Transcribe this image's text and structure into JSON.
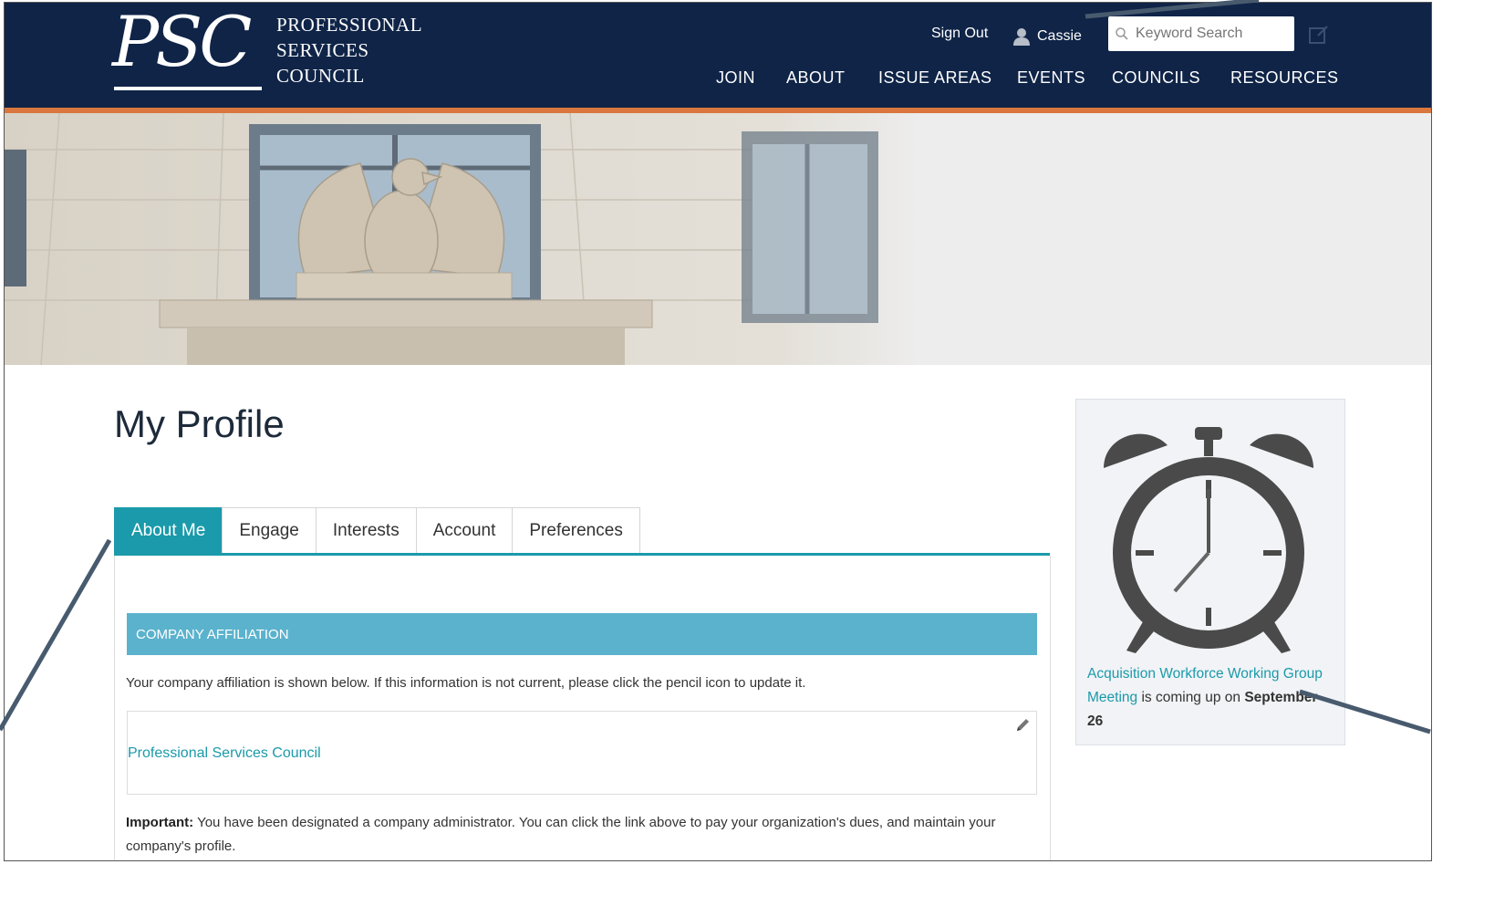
{
  "logo": {
    "mark": "PSC",
    "line1": "PROFESSIONAL",
    "line2": "SERVICES",
    "line3": "COUNCIL"
  },
  "header": {
    "sign_out": "Sign Out",
    "user_name": "Cassie",
    "search_placeholder": "Keyword Search"
  },
  "nav": {
    "items": [
      "JOIN",
      "ABOUT",
      "ISSUE AREAS",
      "EVENTS",
      "COUNCILS",
      "RESOURCES"
    ]
  },
  "main": {
    "title": "My Profile",
    "tabs": [
      "About Me",
      "Engage",
      "Interests",
      "Account",
      "Preferences"
    ],
    "active_tab": "About Me",
    "section_heading": "COMPANY AFFILIATION",
    "description": "Your company affiliation is shown below. If this information is not current, please click the pencil icon to update it.",
    "company_link": "Professional Services Council",
    "important_label": "Important:",
    "important_text": " You have been designated a company administrator. You can click the link above to pay your organization's dues, and maintain your company's profile."
  },
  "sidebar": {
    "event_link": "Acquisition Workforce Working Group Meeting",
    "event_text": " is coming up on ",
    "event_date": "September 26",
    "icon": "alarm-clock-icon"
  },
  "colors": {
    "header_bg": "#0f2447",
    "accent_orange": "#d9773e",
    "teal": "#1a9aaa",
    "section_blue": "#5bb2cd"
  }
}
